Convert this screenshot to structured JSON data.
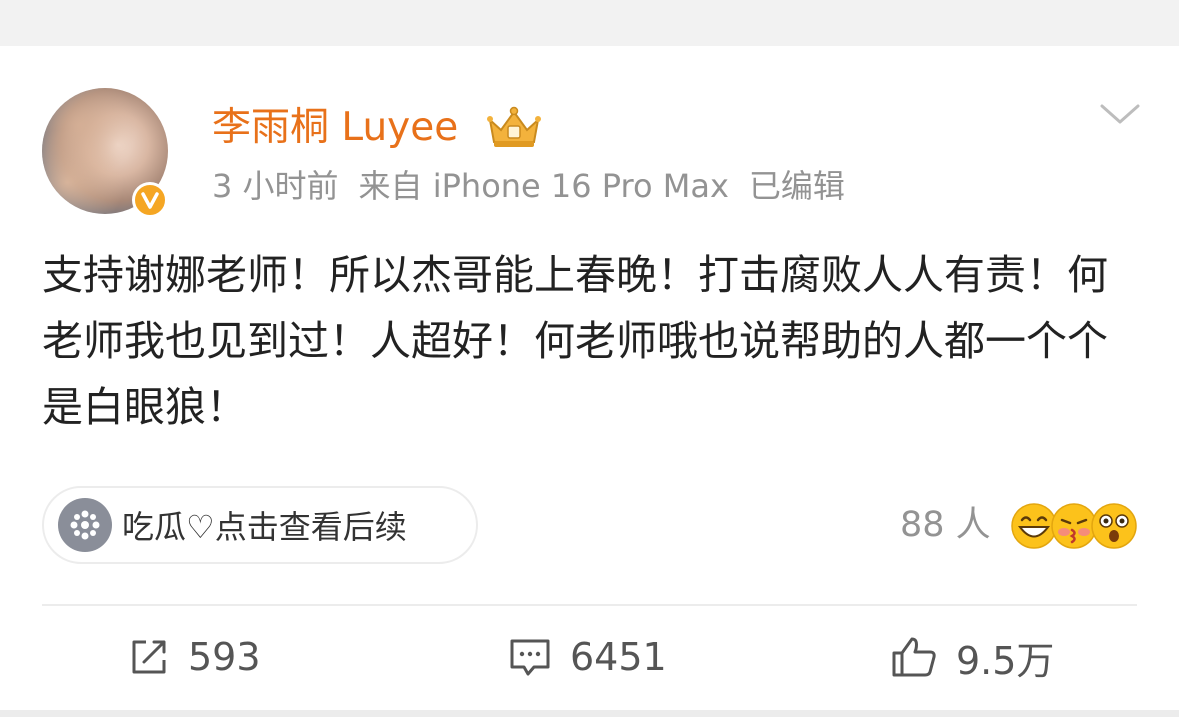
{
  "post": {
    "username": "李雨桐 Luyee",
    "time": "3 小时前",
    "source": "来自 iPhone 16 Pro Max",
    "edited": "已编辑",
    "text": "支持谢娜老师！所以杰哥能上春晚！打击腐败人人有责！何老师我也见到过！人超好！何老师哦也说帮助的人都一个个是白眼狼！",
    "topic_label": "吃瓜♡点击查看后续",
    "reaction_count": "88 人"
  },
  "actions": {
    "repost": "593",
    "comment": "6451",
    "like": "9.5万"
  },
  "icons": {
    "crown": "crown-member-icon",
    "verified": "verified-v-icon",
    "chevron": "chevron-down-icon",
    "topic": "topic-flower-icon",
    "repost": "repost-icon",
    "comment": "comment-icon",
    "like": "thumbs-up-icon",
    "emojis": [
      "grin-emoji-icon",
      "kiss-emoji-icon",
      "surprised-emoji-icon"
    ]
  },
  "colors": {
    "username": "#e8711a",
    "meta": "#939393",
    "text": "#222222",
    "badge": "#f5a623"
  }
}
